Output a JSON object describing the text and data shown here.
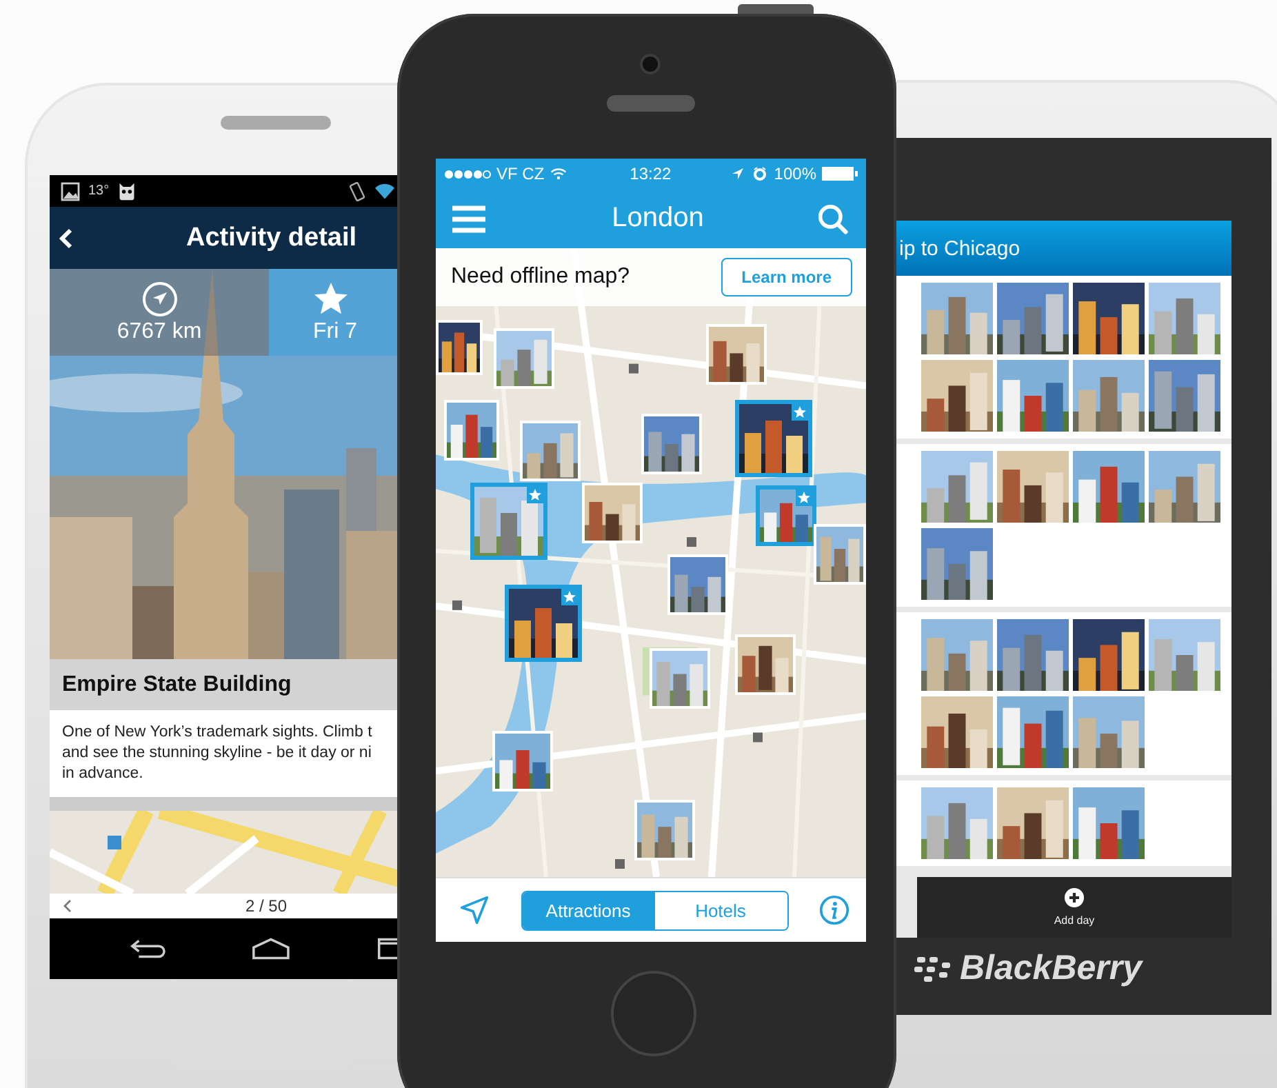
{
  "android": {
    "status_bar": {
      "temperature": "13°"
    },
    "title": "Activity detail",
    "stats": [
      {
        "kind": "distance",
        "value": "6767 km"
      },
      {
        "kind": "date",
        "value": "Fri 7"
      }
    ],
    "heading": "Empire State Building",
    "description": "One of New York’s trademark sights. Climb t\nand see the stunning skyline - be it day or ni\nin advance.",
    "pager": "2 / 50"
  },
  "iphone": {
    "status_bar": {
      "carrier": "VF CZ",
      "time": "13:22",
      "battery": "100%"
    },
    "title": "London",
    "banner": {
      "text": "Need offline map?",
      "button": "Learn more"
    },
    "places": [
      {
        "starred": false
      },
      {
        "starred": false
      },
      {
        "starred": false
      },
      {
        "starred": false
      },
      {
        "starred": false
      },
      {
        "starred": false
      },
      {
        "starred": true
      },
      {
        "starred": true
      },
      {
        "starred": false
      },
      {
        "starred": true
      },
      {
        "starred": false
      },
      {
        "starred": false
      },
      {
        "starred": true
      },
      {
        "starred": false
      },
      {
        "starred": false
      },
      {
        "starred": false
      },
      {
        "starred": false
      }
    ],
    "tabs": [
      {
        "label": "Attractions",
        "selected": true
      },
      {
        "label": "Hotels",
        "selected": false
      }
    ]
  },
  "blackberry": {
    "title": "ip to Chicago",
    "add_button": "Add day",
    "brand": "BlackBerry"
  }
}
